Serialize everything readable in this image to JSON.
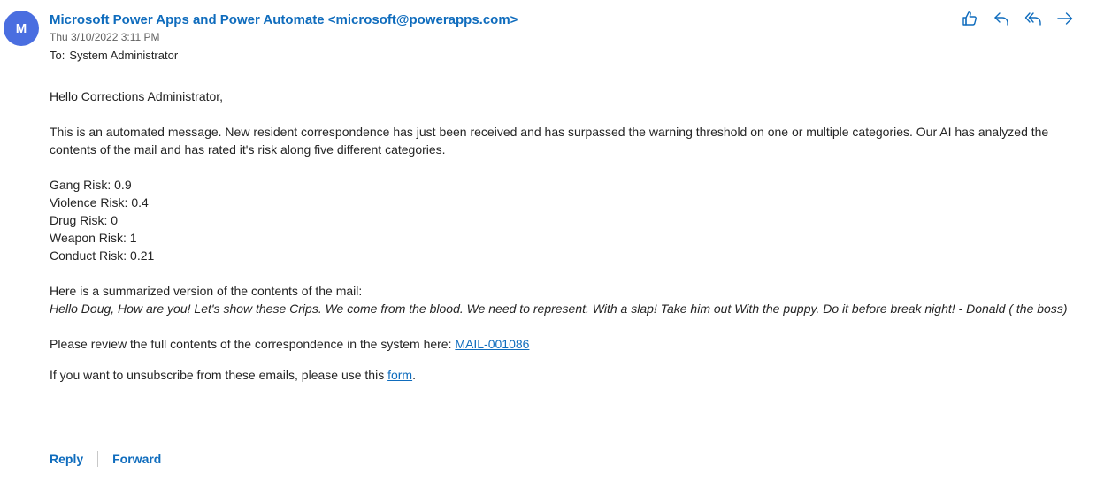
{
  "sender": {
    "avatar_initial": "M",
    "from": "Microsoft Power Apps and Power Automate <microsoft@powerapps.com>",
    "date": "Thu 3/10/2022 3:11 PM",
    "to_label": "To:",
    "to_value": "System Administrator"
  },
  "actions": [
    {
      "name": "like",
      "icon": "thumbs-up-icon"
    },
    {
      "name": "reply",
      "icon": "reply-icon"
    },
    {
      "name": "reply-all",
      "icon": "reply-all-icon"
    },
    {
      "name": "forward",
      "icon": "forward-arrow-icon"
    }
  ],
  "body": {
    "greeting": "Hello Corrections Administrator,",
    "intro": "This is an automated message. New resident correspondence has just been received and has surpassed the warning threshold on one or multiple categories. Our AI has analyzed the contents of the mail and has rated it's risk along five different categories.",
    "risks": [
      "Gang Risk: 0.9",
      "Violence Risk: 0.4",
      "Drug Risk: 0",
      "Weapon Risk: 1",
      "Conduct Risk: 0.21"
    ],
    "summary_label": "Here is a summarized version of the contents of the mail:",
    "summary_text": "Hello Doug, How are you! Let's show these Crips. We come from the blood. We need to represent. With a slap! Take him out With the puppy. Do it before break night! - Donald ( the boss)",
    "review_text": "Please review the full contents of the correspondence in the system here: ",
    "review_link": "MAIL-001086",
    "unsubscribe_text": "If you want to unsubscribe from these emails, please use this ",
    "unsubscribe_link": "form",
    "unsubscribe_end": "."
  },
  "footer": {
    "reply_label": "Reply",
    "forward_label": "Forward"
  },
  "colors": {
    "accent": "#0f6cbd",
    "avatar": "#4a6ee0"
  }
}
